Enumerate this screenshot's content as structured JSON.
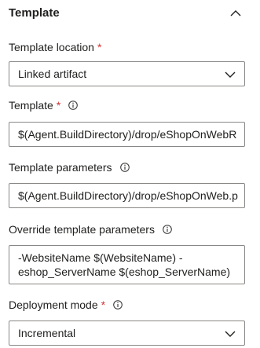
{
  "section": {
    "title": "Template",
    "collapse_icon": "chevron-up-icon"
  },
  "fields": {
    "template_location": {
      "label": "Template location",
      "required_mark": "*",
      "value": "Linked artifact"
    },
    "template": {
      "label": "Template",
      "required_mark": "*",
      "value": "$(Agent.BuildDirectory)/drop/eShopOnWebR"
    },
    "template_parameters": {
      "label": "Template parameters",
      "value": "$(Agent.BuildDirectory)/drop/eShopOnWeb.p"
    },
    "override_template_parameters": {
      "label": "Override template parameters",
      "value": "-WebsiteName $(WebsiteName) -eshop_ServerName $(eshop_ServerName)"
    },
    "deployment_mode": {
      "label": "Deployment mode",
      "required_mark": "*",
      "value": "Incremental"
    }
  },
  "colors": {
    "required": "#d13438",
    "border": "#8a8886",
    "text": "#201f1e"
  }
}
